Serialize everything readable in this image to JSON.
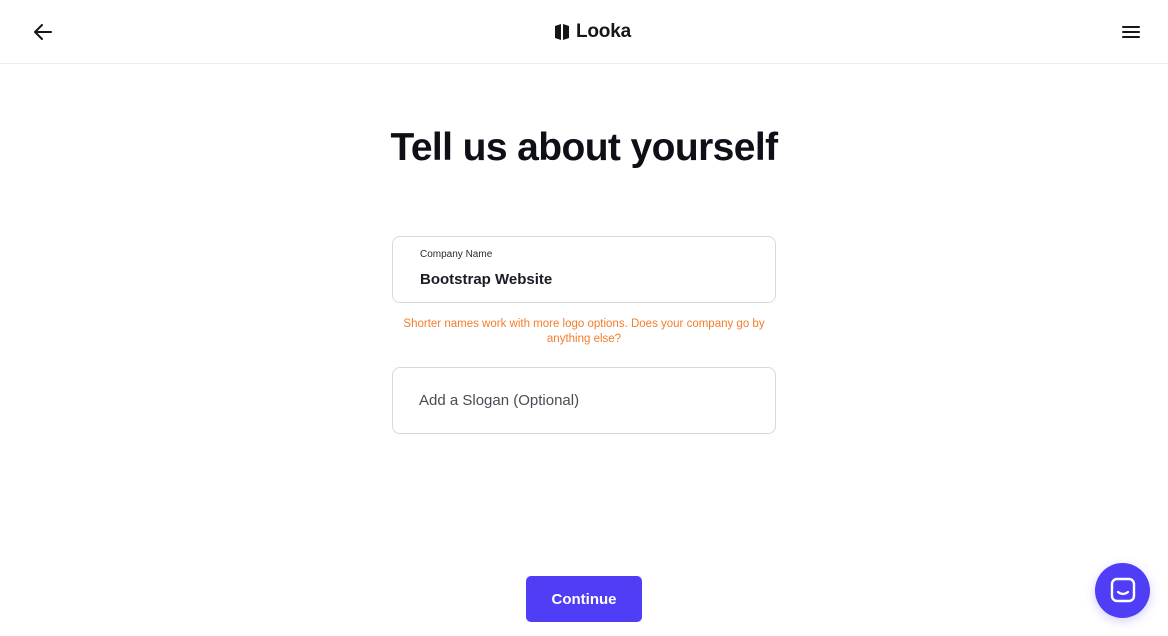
{
  "header": {
    "brand_name": "Looka",
    "back_icon": "arrow-left-icon",
    "menu_icon": "hamburger-menu-icon",
    "logo_icon": "looka-logo-icon"
  },
  "main": {
    "title": "Tell us about yourself",
    "company_field": {
      "label": "Company Name",
      "value": "Bootstrap Website"
    },
    "hint": "Shorter names work with more logo options. Does your company go by anything else?",
    "slogan_field": {
      "value": "",
      "placeholder": "Add a Slogan (Optional)"
    },
    "continue_label": "Continue"
  },
  "chat": {
    "icon": "chat-bubble-icon"
  },
  "colors": {
    "accent": "#4f3ef5",
    "hint": "#f47c2c",
    "text": "#111218",
    "border": "#d7d9e2"
  }
}
